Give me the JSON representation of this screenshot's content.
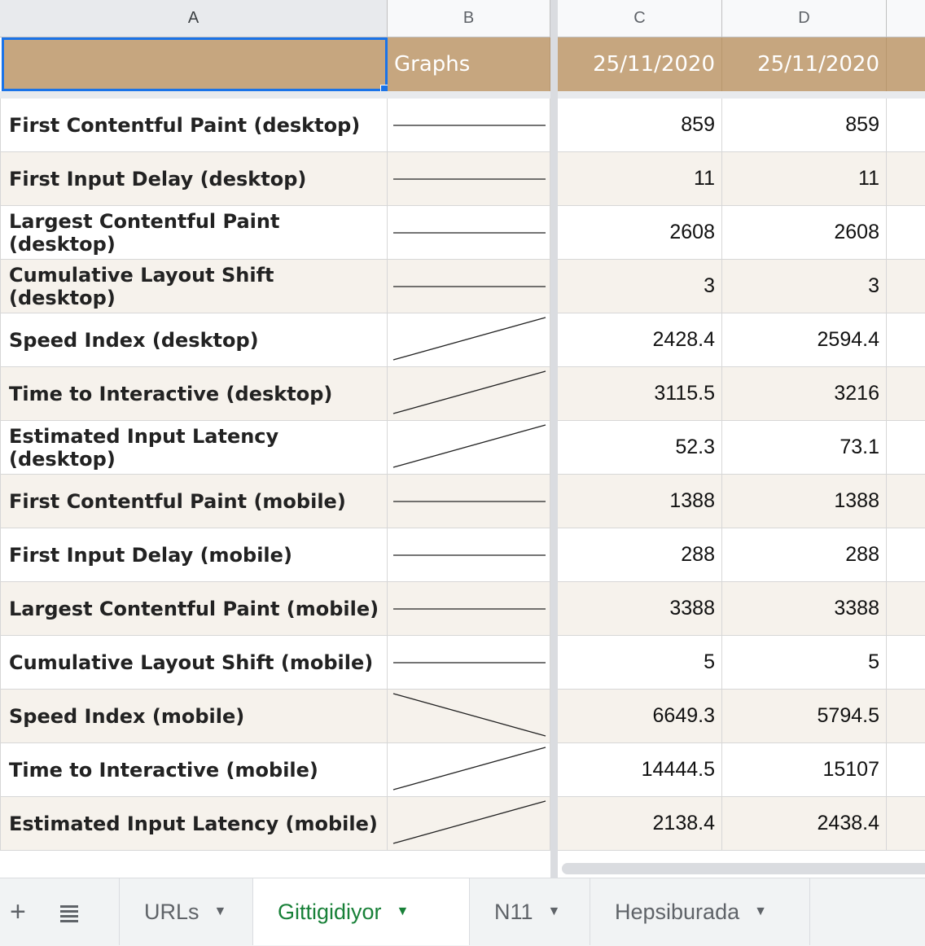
{
  "columns": [
    "A",
    "B",
    "C",
    "D"
  ],
  "header_row": {
    "a": "",
    "b": "Graphs",
    "c": "25/11/2020",
    "d": "25/11/2020"
  },
  "rows": [
    {
      "label": "First Contentful Paint (desktop)",
      "c": "859",
      "d": "859",
      "trend": "flat"
    },
    {
      "label": "First Input Delay (desktop)",
      "c": "11",
      "d": "11",
      "trend": "flat"
    },
    {
      "label": "Largest Contentful Paint (desktop)",
      "c": "2608",
      "d": "2608",
      "trend": "flat"
    },
    {
      "label": "Cumulative Layout Shift (desktop)",
      "c": "3",
      "d": "3",
      "trend": "flat"
    },
    {
      "label": "Speed Index (desktop)",
      "c": "2428.4",
      "d": "2594.4",
      "trend": "up"
    },
    {
      "label": "Time to Interactive (desktop)",
      "c": "3115.5",
      "d": "3216",
      "trend": "up"
    },
    {
      "label": "Estimated Input Latency (desktop)",
      "c": "52.3",
      "d": "73.1",
      "trend": "up"
    },
    {
      "label": "First Contentful Paint (mobile)",
      "c": "1388",
      "d": "1388",
      "trend": "flat"
    },
    {
      "label": "First Input Delay (mobile)",
      "c": "288",
      "d": "288",
      "trend": "flat"
    },
    {
      "label": "Largest Contentful Paint (mobile)",
      "c": "3388",
      "d": "3388",
      "trend": "flat"
    },
    {
      "label": "Cumulative Layout Shift (mobile)",
      "c": "5",
      "d": "5",
      "trend": "flat"
    },
    {
      "label": "Speed Index (mobile)",
      "c": "6649.3",
      "d": "5794.5",
      "trend": "down"
    },
    {
      "label": "Time to Interactive (mobile)",
      "c": "14444.5",
      "d": "15107",
      "trend": "up"
    },
    {
      "label": "Estimated Input Latency (mobile)",
      "c": "2138.4",
      "d": "2438.4",
      "trend": "up"
    }
  ],
  "tabbar": {
    "add_icon": "plus-icon",
    "list_icon": "sheet-list-icon",
    "tabs": [
      {
        "label": "URLs",
        "active": false
      },
      {
        "label": "Gittigidiyor",
        "active": true
      },
      {
        "label": "N11",
        "active": false
      },
      {
        "label": "Hepsiburada",
        "active": false
      }
    ]
  },
  "colors": {
    "header_fill": "#c6a67f",
    "band_fill": "#f6f2ec",
    "selection": "#1a73e8",
    "active_tab": "#188038"
  }
}
